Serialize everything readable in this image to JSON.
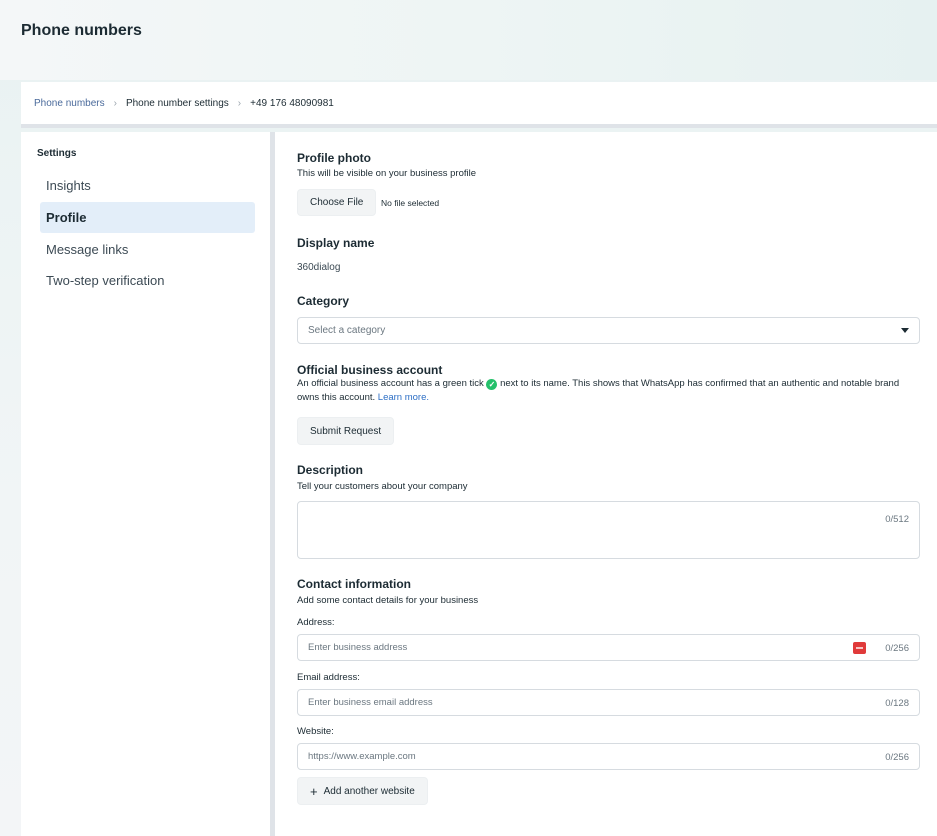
{
  "page": {
    "title": "Phone numbers"
  },
  "breadcrumb": {
    "items": [
      "Phone numbers",
      "Phone number settings",
      "+49 176 48090981"
    ],
    "separator": "›"
  },
  "sidebar": {
    "title": "Settings",
    "items": [
      {
        "label": "Insights",
        "active": false
      },
      {
        "label": "Profile",
        "active": true
      },
      {
        "label": "Message links",
        "active": false
      },
      {
        "label": "Two-step verification",
        "active": false
      }
    ]
  },
  "profile_photo": {
    "title": "Profile photo",
    "subtitle": "This will be visible on your business profile",
    "button_label": "Choose File",
    "file_status": "No file selected"
  },
  "display_name": {
    "title": "Display name",
    "value": "360dialog"
  },
  "category": {
    "title": "Category",
    "placeholder": "Select a category"
  },
  "official_account": {
    "title": "Official business account",
    "text_before": "An official business account has a green tick",
    "tick_icon": "✓",
    "text_after": "next to its name. This shows that WhatsApp has confirmed that an authentic and notable brand owns this account.",
    "link_label": "Learn more.",
    "button_label": "Submit Request"
  },
  "description": {
    "title": "Description",
    "subtitle": "Tell your customers about your company",
    "counter": "0/512"
  },
  "contact": {
    "title": "Contact information",
    "subtitle": "Add some contact details for your business",
    "address": {
      "label": "Address:",
      "placeholder": "Enter business address",
      "counter": "0/256"
    },
    "email": {
      "label": "Email address:",
      "placeholder": "Enter business email address",
      "counter": "0/128"
    },
    "website": {
      "label": "Website:",
      "placeholder": "https://www.example.com",
      "counter": "0/256"
    },
    "add_website_icon": "+",
    "add_website_label": "Add another website"
  },
  "colors": {
    "accent_active": "#e3eef9",
    "link": "#2d6fc5",
    "tick": "#25c06b"
  }
}
